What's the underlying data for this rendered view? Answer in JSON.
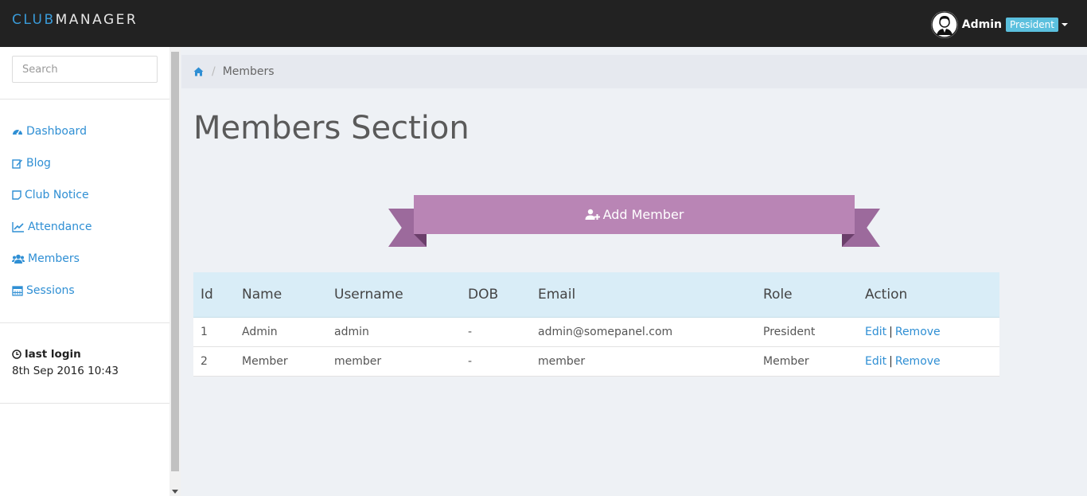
{
  "brand": {
    "prefix": "CLUB",
    "suffix": "MANAGER"
  },
  "user": {
    "name": "Admin",
    "role": "President"
  },
  "search": {
    "placeholder": "Search"
  },
  "sidebar": {
    "items": [
      {
        "label": "Dashboard",
        "icon": "dashboard-icon"
      },
      {
        "label": "Blog",
        "icon": "edit-icon"
      },
      {
        "label": "Club Notice",
        "icon": "sticky-note-icon"
      },
      {
        "label": "Attendance",
        "icon": "line-chart-icon"
      },
      {
        "label": "Members",
        "icon": "users-icon"
      },
      {
        "label": "Sessions",
        "icon": "calendar-icon"
      }
    ],
    "last_login": {
      "title": "last login",
      "time": "8th Sep 2016 10:43"
    }
  },
  "breadcrumb": {
    "home_icon": "home-icon",
    "current": "Members"
  },
  "page": {
    "title": "Members Section",
    "add_button": "Add Member"
  },
  "table": {
    "headers": [
      "Id",
      "Name",
      "Username",
      "DOB",
      "Email",
      "Role",
      "Action"
    ],
    "rows": [
      {
        "id": "1",
        "name": "Admin",
        "username": "admin",
        "dob": "-",
        "email": "admin@somepanel.com",
        "role": "President",
        "edit": "Edit",
        "sep": "|",
        "remove": "Remove"
      },
      {
        "id": "2",
        "name": "Member",
        "username": "member",
        "dob": "-",
        "email": "member",
        "role": "Member",
        "edit": "Edit",
        "sep": "|",
        "remove": "Remove"
      }
    ]
  },
  "colors": {
    "navbar": "#222222",
    "link": "#2f8fd4",
    "ribbon": "#b985b5",
    "badge": "#5bc0de",
    "table_header": "#d9edf7"
  }
}
